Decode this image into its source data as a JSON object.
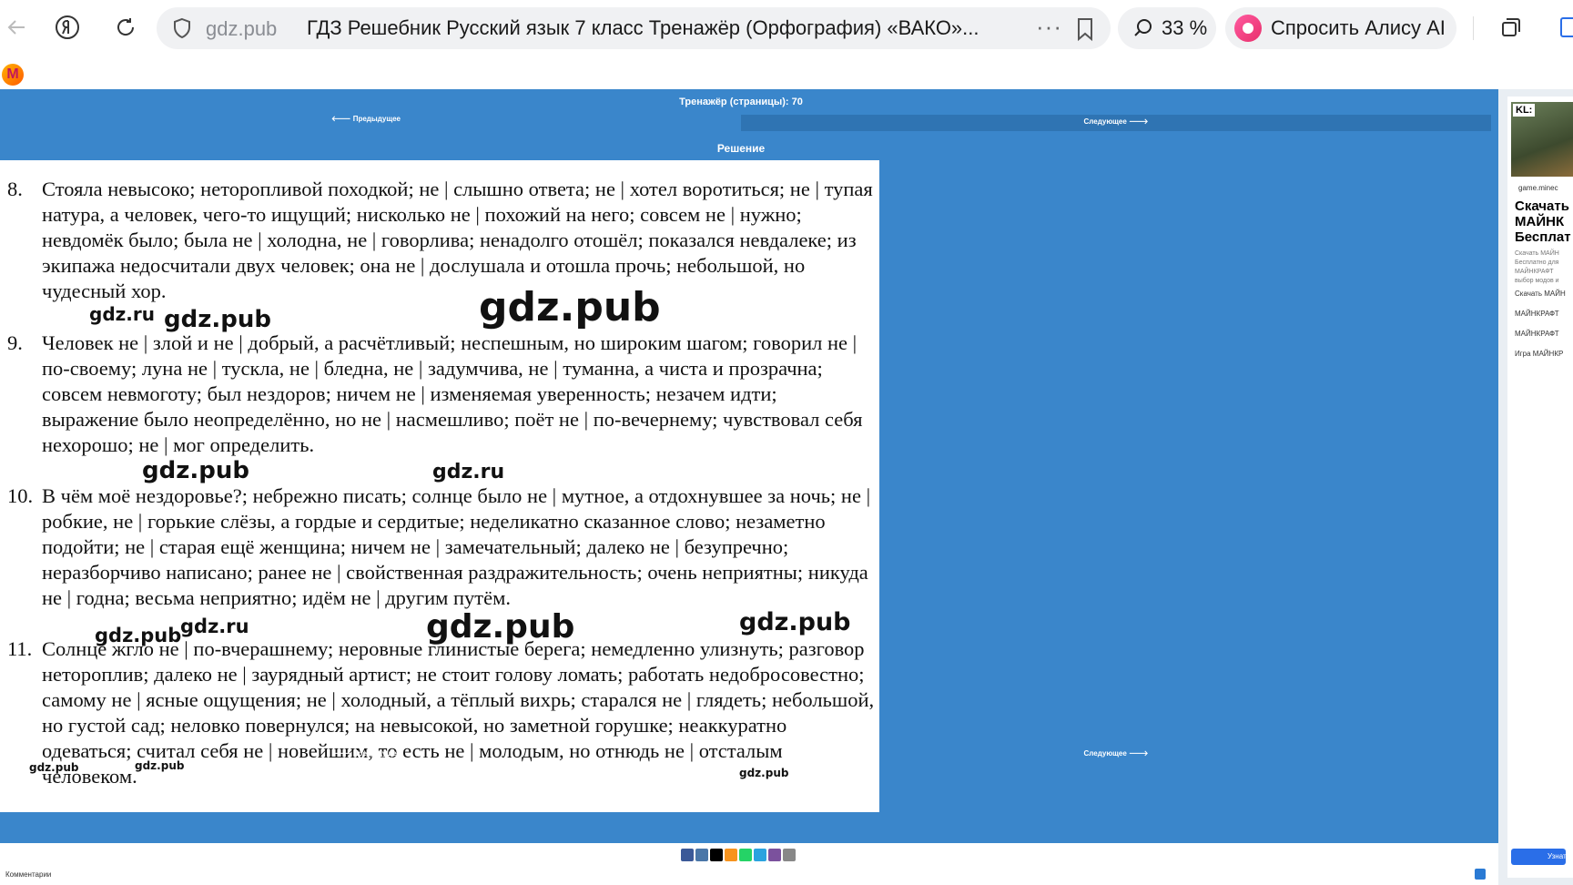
{
  "browser": {
    "domain": "gdz.pub",
    "tab_title": "ГДЗ Решебник Русский язык 7 класс Тренажёр (Орфография) «ВАКО»...",
    "zoom": "33 %",
    "alice_label": "Спросить Алису AI",
    "more_label": "···"
  },
  "page": {
    "title": "Тренажёр (страницы): 70",
    "prev_label": "🡐 Предыдущее",
    "next_label": "Следующее 🡒",
    "solution_label": "Решение",
    "comments_label": "Комментарии"
  },
  "items": [
    {
      "num": "8.",
      "text": "Стояла невысоко; неторопливой походкой; не | слышно ответа; не | хотел воротиться; не | тупая натура, а человек, чего-то ищущий; нисколько не | похожий на него; совсем не | нужно; невдомёк было; была не | холодна, не | говорлива; ненадолго отошёл; показался невдалеке; из экипажа недосчитали двух человек; она не | дослушала и отошла прочь; небольшой, но чудесный хор."
    },
    {
      "num": "9.",
      "text": "Человек не | злой и не | добрый, а расчётливый; неспешным, но широким шагом; говорил не | по-своему; луна не | тускла, не | бледна, не | задумчива, не | туманна, а чиста и прозрачна; совсем невмоготу; был нездоров; ничем не | изменяемая уверенность; незачем идти; выражение было неопределённо, но не | насмешливо; поёт не | по-вечернему; чувствовал себя нехорошо; не | мог определить."
    },
    {
      "num": "10.",
      "text": "В чём моё нездоровье?; небрежно писать; солнце было не | мутное, а отдохнувшее за ночь; не | робкие, не | горькие слёзы, а гордые и сердитые; неделикатно сказанное слово; незаметно подойти; не | старая ещё женщина; ничем не | замечательный; далеко не | безупречно; неразборчиво написано; ранее не | свойственная раздражительность; очень неприятны; никуда не | годна; весьма неприятно; идём не | другим путём."
    },
    {
      "num": "11.",
      "text": "Солнце жгло не | по-вчерашнему; неровные глинистые берега; немедленно улизнуть; разговор нетороплив; далеко не | заурядный артист; не стоит голову ломать; работать недобросовестно; самому не | ясные ощущения; не  | холодный, а тёплый вихрь; старался не  | глядеть; небольшой, но густой сад; неловко повернулся; на невысокой, но заметной горушке; неаккуратно одеваться; считал себя не | новейшим, то есть не | молодым, но отнюдь не | отсталым человеком."
    }
  ],
  "watermarks": {
    "pub": "gdz.pub",
    "ru": "gdz.ru"
  },
  "ad": {
    "badge": "KL:",
    "source": "game.minec",
    "headline": [
      "Скачать",
      "МАЙНК",
      "Бесплат"
    ],
    "desc": [
      "Скачать МАЙН",
      "Бесплатно для",
      "МАЙНКРАФТ",
      "выбор модов и"
    ],
    "links": [
      "Скачать МАЙН",
      "МАЙНКРАФТ",
      "МАЙНКРАФТ",
      "Игра МАЙНКР"
    ],
    "button": "Узнат"
  }
}
